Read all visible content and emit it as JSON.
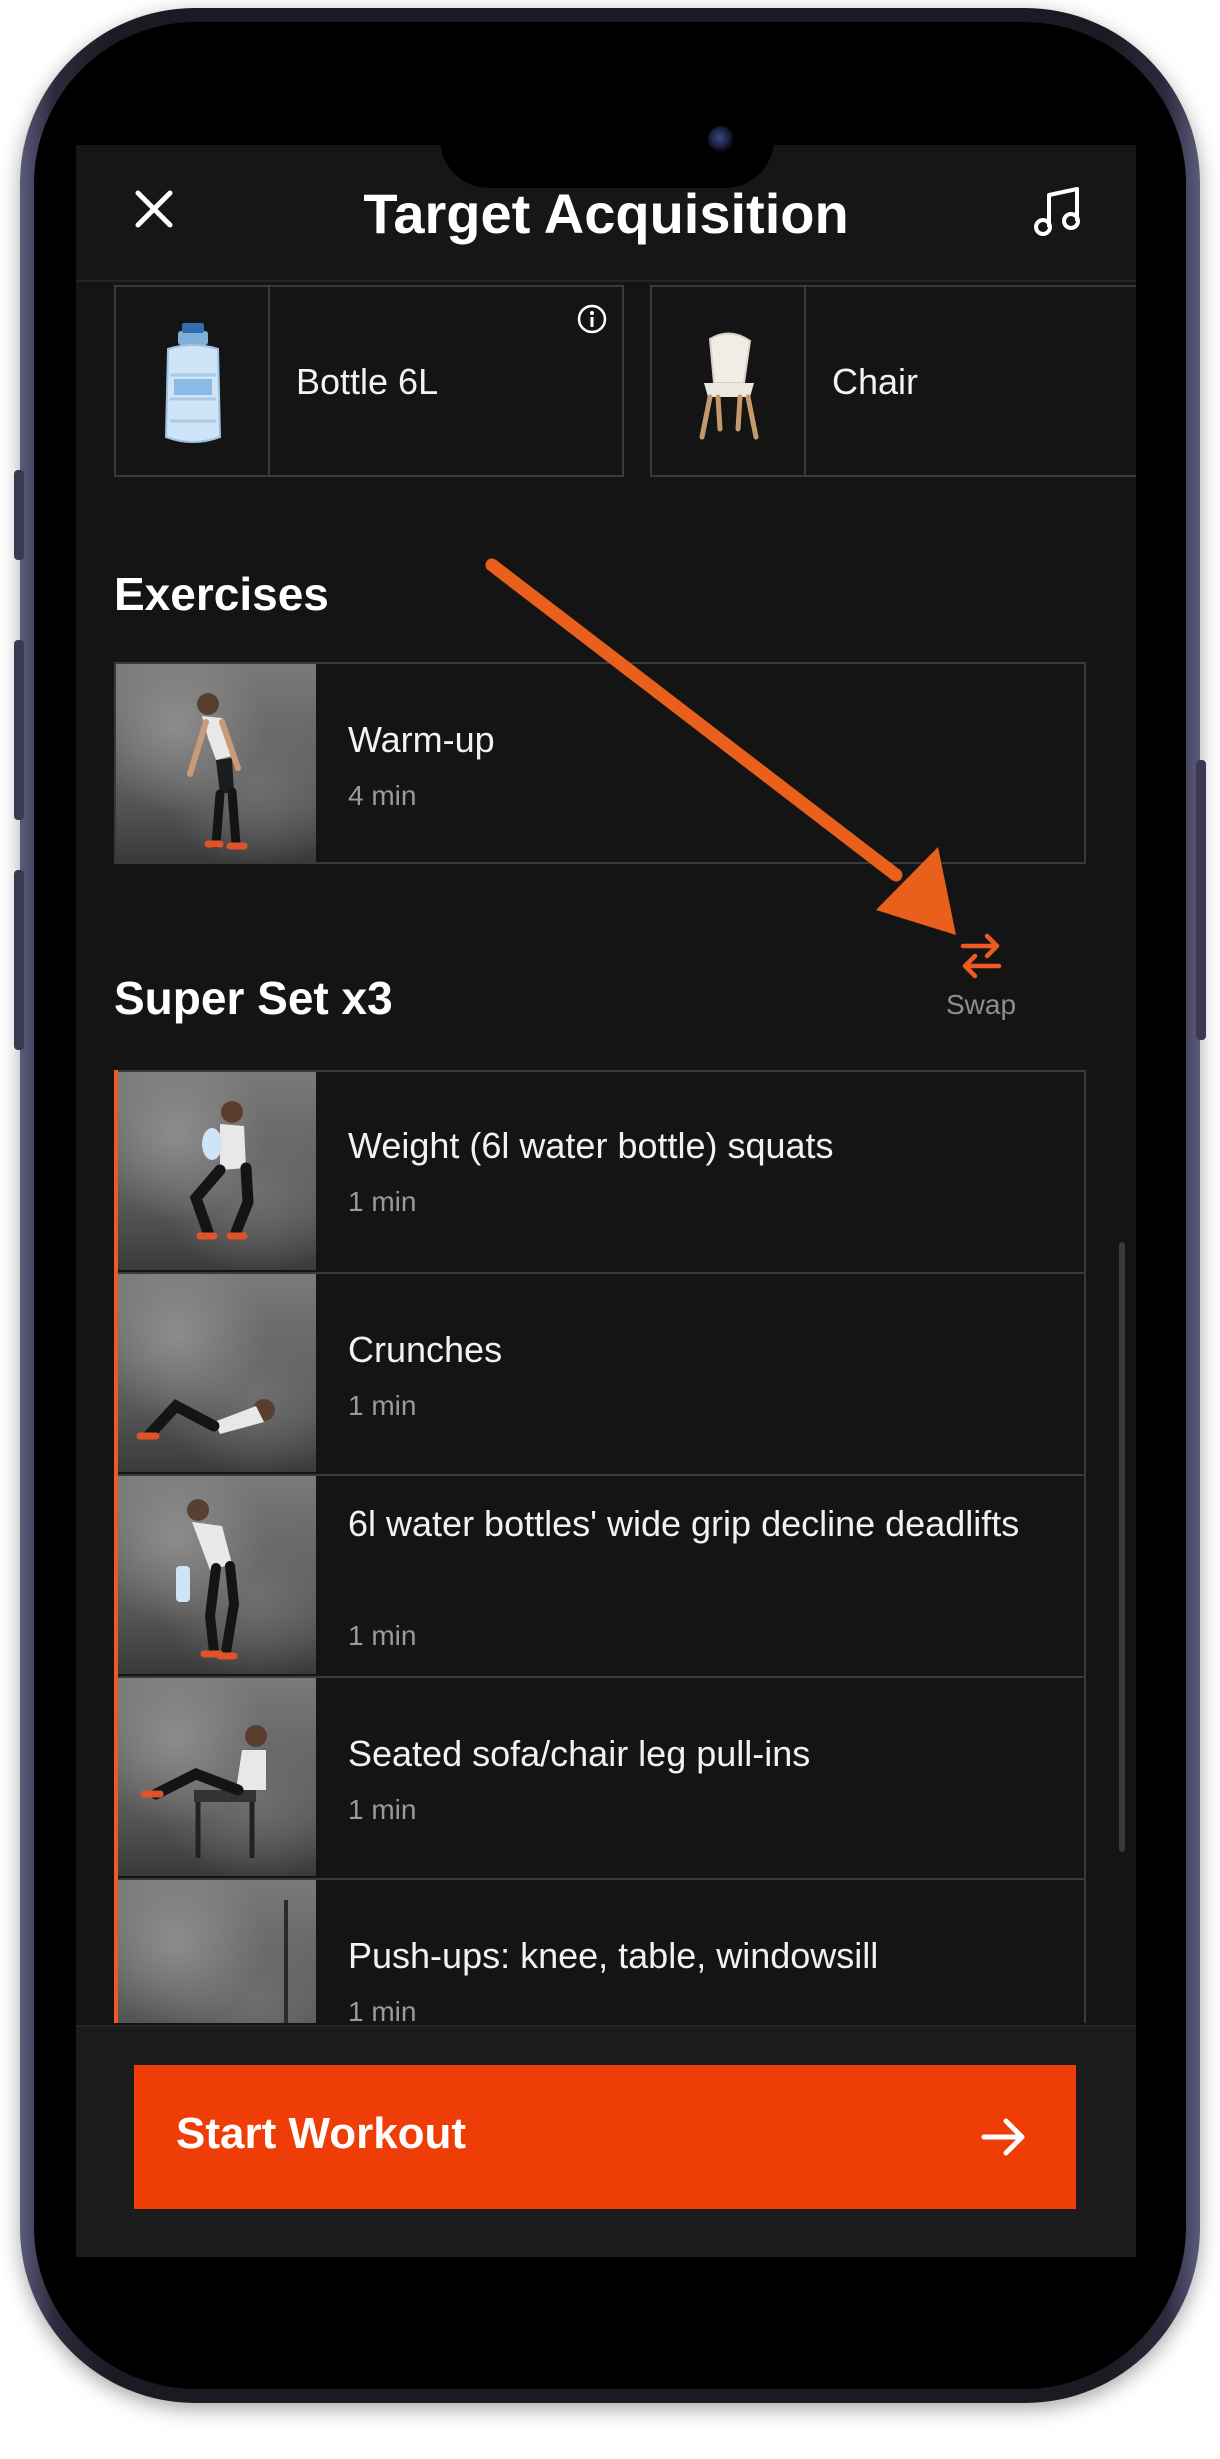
{
  "header": {
    "title": "Target Acquisition",
    "close_icon": "close-icon",
    "music_icon": "music-note-icon"
  },
  "equipment": [
    {
      "label": "Bottle 6L",
      "icon": "water-bottle-image"
    },
    {
      "label": "Chair",
      "icon": "chair-image"
    }
  ],
  "exercises": {
    "title": "Exercises",
    "items": [
      {
        "name": "Warm-up",
        "duration": "4 min"
      }
    ]
  },
  "superset": {
    "title": "Super Set x3",
    "swap_label": "Swap",
    "swap_icon": "swap-arrows-icon",
    "items": [
      {
        "name": "Weight (6l water bottle) squats",
        "duration": "1 min"
      },
      {
        "name": "Crunches",
        "duration": "1 min"
      },
      {
        "name": "6l water bottles' wide grip decline deadlifts",
        "duration": "1 min"
      },
      {
        "name": "Seated sofa/chair leg pull-ins",
        "duration": "1 min"
      },
      {
        "name": "Push-ups: knee, table, windowsill",
        "duration": "1 min"
      }
    ]
  },
  "footer": {
    "start_label": "Start Workout",
    "arrow_icon": "arrow-right-icon"
  },
  "colors": {
    "accent": "#ee3d07",
    "annotation": "#e8601c",
    "background": "#141414",
    "border": "#3a3a3a"
  }
}
